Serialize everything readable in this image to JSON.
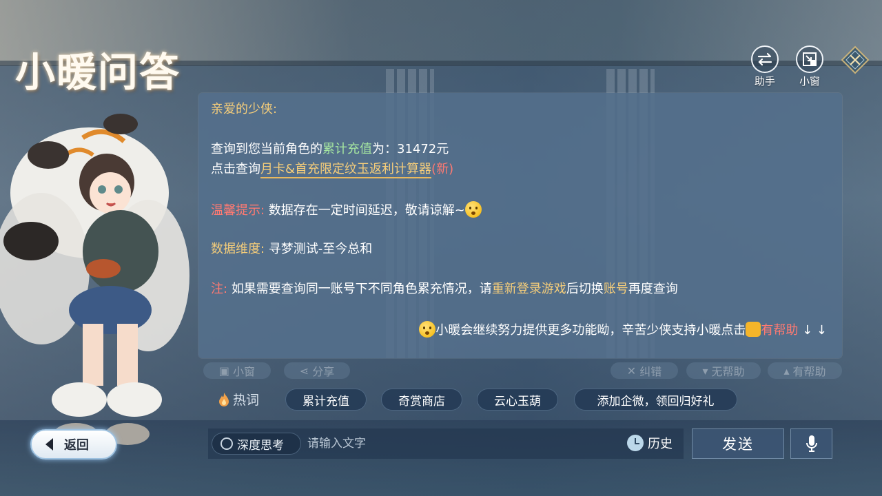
{
  "header": {
    "title": "小暖问答",
    "assistant_label": "助手",
    "mini_window_label": "小窗"
  },
  "message": {
    "greeting": "亲爱的少侠:",
    "query_prefix": "查询到您当前角色的",
    "query_highlight": "累计充值",
    "query_suffix": "为：31472元",
    "click_prefix": "点击查询",
    "calculator_link": "月卡&首充限定纹玉返利计算器",
    "new_tag": "(新)",
    "tip_label": "温馨提示:",
    "tip_text": "数据存在一定时间延迟，敬请谅解~",
    "dimension_label": "数据维度:",
    "dimension_text": "寻梦测试-至今总和",
    "note_label": "注:",
    "note_prefix": "如果需要查询同一账号下不同角色累充情况，请",
    "note_highlight1": "重新登录游戏",
    "note_middle": "后切换",
    "note_highlight2": "账号",
    "note_suffix": "再度查询",
    "closing_text": "小暖会继续努力提供更多功能呦，辛苦少侠支持小暖点击",
    "closing_helpful": "有帮助",
    "closing_arrows": "↓ ↓"
  },
  "actions": {
    "mini_window": "小窗",
    "share": "分享",
    "correct": "纠错",
    "not_helpful": "无帮助",
    "helpful": "有帮助"
  },
  "hot_words": {
    "label": "热词",
    "chips": [
      "累计充值",
      "奇赏商店",
      "云心玉葫",
      "添加企微，领回归好礼"
    ]
  },
  "bottom": {
    "back_label": "返回",
    "deep_think_label": "深度思考",
    "input_placeholder": "请输入文字",
    "history_label": "历史",
    "send_label": "发送"
  },
  "colors": {
    "gold": "#f5cd7a",
    "green": "#a6e6a0",
    "red": "#ff7a72",
    "panel": "#54708c"
  }
}
